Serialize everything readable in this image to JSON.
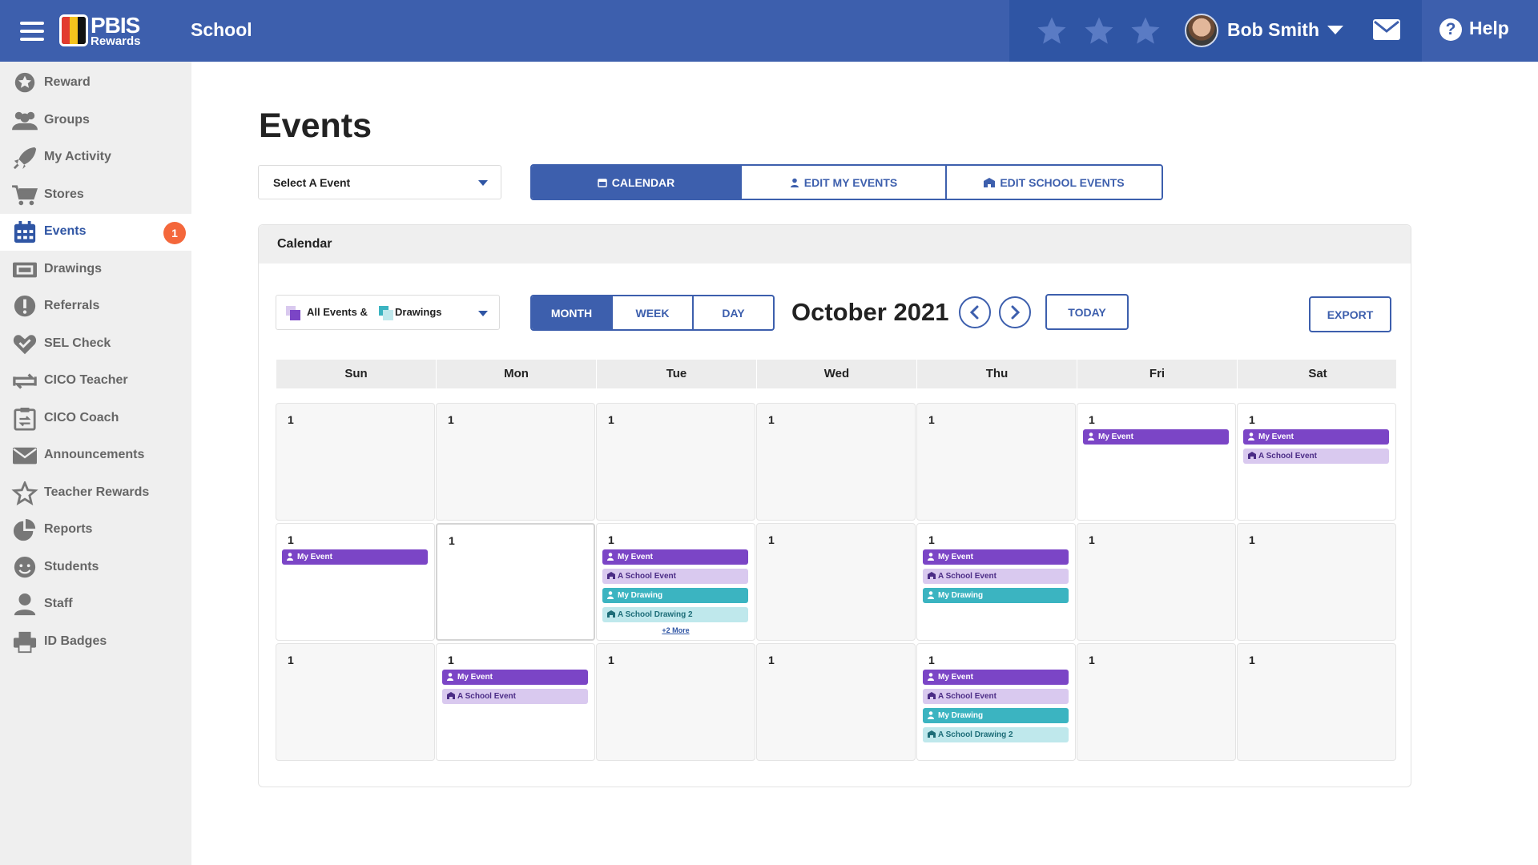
{
  "header": {
    "logo_line1": "PBIS",
    "logo_line2": "Rewards",
    "school_label": "School",
    "user_name": "Bob Smith",
    "help_label": "Help",
    "colors": {
      "bar": "#3d5fad",
      "user_area": "#2f55a4",
      "star": "#5a7bc4"
    }
  },
  "sidebar": {
    "items": [
      {
        "label": "Reward",
        "icon": "star-badge-icon"
      },
      {
        "label": "Groups",
        "icon": "users-icon"
      },
      {
        "label": "My Activity",
        "icon": "rocket-icon"
      },
      {
        "label": "Stores",
        "icon": "cart-icon"
      },
      {
        "label": "Events",
        "icon": "calendar-icon",
        "active": true,
        "badge": "1"
      },
      {
        "label": "Drawings",
        "icon": "ticket-icon"
      },
      {
        "label": "Referrals",
        "icon": "exclamation-icon"
      },
      {
        "label": "SEL Check",
        "icon": "heart-check-icon"
      },
      {
        "label": "CICO Teacher",
        "icon": "swap-icon"
      },
      {
        "label": "CICO Coach",
        "icon": "clipboard-icon"
      },
      {
        "label": "Announcements",
        "icon": "envelope-icon"
      },
      {
        "label": "Teacher Rewards",
        "icon": "star-outline-icon"
      },
      {
        "label": "Reports",
        "icon": "pie-chart-icon"
      },
      {
        "label": "Students",
        "icon": "smile-icon"
      },
      {
        "label": "Staff",
        "icon": "person-icon"
      },
      {
        "label": "ID Badges",
        "icon": "printer-icon"
      }
    ]
  },
  "main": {
    "title": "Events",
    "event_select": "Select A Event",
    "modes": [
      "CALENDAR",
      "EDIT MY EVENTS",
      "EDIT SCHOOL EVENTS"
    ],
    "calendar": {
      "card_title": "Calendar",
      "filter": {
        "part1": "All Events &",
        "part2": "Drawings"
      },
      "views": [
        "MONTH",
        "WEEK",
        "DAY"
      ],
      "month_title": "October 2021",
      "today_label": "TODAY",
      "export_label": "EXPORT",
      "weekdays": [
        "Sun",
        "Mon",
        "Tue",
        "Wed",
        "Thu",
        "Fri",
        "Sat"
      ],
      "event_colors": {
        "my_event": "#7b45c6",
        "school_event": "#d9c9ef",
        "my_drawing": "#3bb4c1",
        "school_drawing": "#bfe8ec"
      },
      "weeks": [
        [
          {
            "day": "1",
            "events": []
          },
          {
            "day": "1",
            "events": []
          },
          {
            "day": "1",
            "events": []
          },
          {
            "day": "1",
            "events": []
          },
          {
            "day": "1",
            "events": []
          },
          {
            "day": "1",
            "events": [
              {
                "type": "my-event",
                "label": "My Event"
              }
            ]
          },
          {
            "day": "1",
            "events": [
              {
                "type": "my-event",
                "label": "My Event"
              },
              {
                "type": "school-event",
                "label": "A School Event"
              }
            ]
          }
        ],
        [
          {
            "day": "1",
            "events": [
              {
                "type": "my-event",
                "label": "My Event"
              }
            ]
          },
          {
            "day": "1",
            "events": [],
            "today": true
          },
          {
            "day": "1",
            "events": [
              {
                "type": "my-event",
                "label": "My Event"
              },
              {
                "type": "school-event",
                "label": "A School Event"
              },
              {
                "type": "my-drawing",
                "label": "My Drawing"
              },
              {
                "type": "school-drawing",
                "label": "A School Drawing 2"
              }
            ],
            "more": "+2 More"
          },
          {
            "day": "1",
            "events": []
          },
          {
            "day": "1",
            "events": [
              {
                "type": "my-event",
                "label": "My Event"
              },
              {
                "type": "school-event",
                "label": "A School Event"
              },
              {
                "type": "my-drawing",
                "label": "My Drawing"
              }
            ]
          },
          {
            "day": "1",
            "events": []
          },
          {
            "day": "1",
            "events": []
          }
        ],
        [
          {
            "day": "1",
            "events": []
          },
          {
            "day": "1",
            "events": [
              {
                "type": "my-event",
                "label": "My Event"
              },
              {
                "type": "school-event",
                "label": "A School Event"
              }
            ]
          },
          {
            "day": "1",
            "events": []
          },
          {
            "day": "1",
            "events": []
          },
          {
            "day": "1",
            "events": [
              {
                "type": "my-event",
                "label": "My Event"
              },
              {
                "type": "school-event",
                "label": "A School Event"
              },
              {
                "type": "my-drawing",
                "label": "My Drawing"
              },
              {
                "type": "school-drawing",
                "label": "A School Drawing 2"
              }
            ]
          },
          {
            "day": "1",
            "events": []
          },
          {
            "day": "1",
            "events": []
          }
        ]
      ]
    }
  }
}
